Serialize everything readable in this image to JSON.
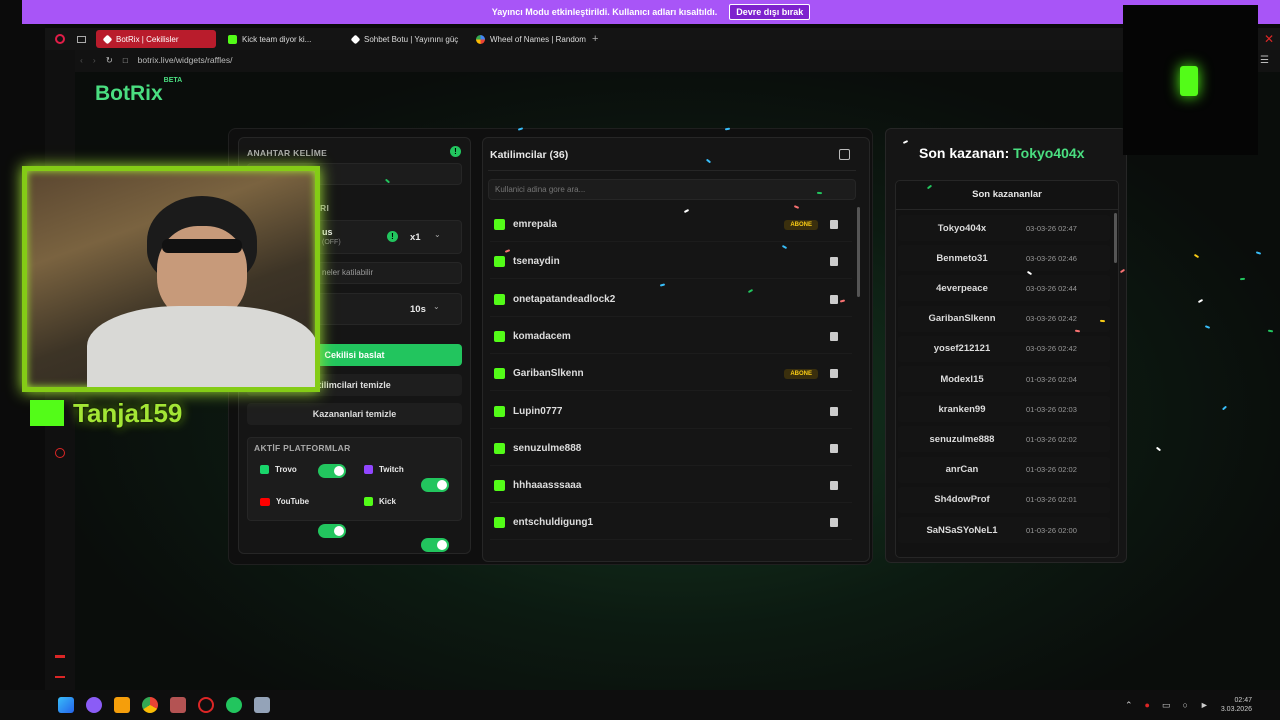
{
  "banner": {
    "text": "Yayıncı Modu etkinleştirildi. Kullanıcı adları kısaltıldı.",
    "button": "Devre dışı bırak"
  },
  "tabs": [
    {
      "label": "BotRix | Cekilisler",
      "color": "#ffffff"
    },
    {
      "label": "Kick team diyor ki...",
      "color": "#53fc18"
    },
    {
      "label": "Sohbet Botu | Yayınını güç",
      "color": "#ffffff"
    },
    {
      "label": "Wheel of Names | Random",
      "color": "#4285f4"
    }
  ],
  "address": "botrix.live/widgets/raffles/",
  "logo": {
    "name": "BotRix",
    "beta": "BETA"
  },
  "left_panel": {
    "keyword_label": "ANAHTAR KELİME",
    "section_fragment": "RI",
    "bonus_fragment": "us",
    "bonus_state": "(OFF)",
    "multiplier": "x1",
    "subs_fragment": "neler katilabilir",
    "timer": "10s",
    "start_button": "Cekilisi baslat",
    "clear_participants": "tilimcilari temizle",
    "clear_winners": "Kazananlari temizle",
    "platforms_label": "AKTİF PLATFORMLAR",
    "platforms": [
      {
        "name": "Trovo",
        "icon": "trovo-icon",
        "enabled": true
      },
      {
        "name": "Twitch",
        "icon": "twitch-icon",
        "enabled": true
      },
      {
        "name": "YouTube",
        "icon": "youtube-icon",
        "enabled": true
      },
      {
        "name": "Kick",
        "icon": "kick-icon",
        "enabled": true
      }
    ]
  },
  "participants": {
    "title": "Katilimcilar (36)",
    "search_placeholder": "Kullanici adina gore ara...",
    "badge_label": "ABONE",
    "items": [
      {
        "name": "emrepala",
        "sub": true
      },
      {
        "name": "tsenaydin",
        "sub": false
      },
      {
        "name": "onetapatandeadlock2",
        "sub": false
      },
      {
        "name": "komadacem",
        "sub": false
      },
      {
        "name": "GaribanSlkenn",
        "sub": true
      },
      {
        "name": "Lupin0777",
        "sub": false
      },
      {
        "name": "senuzulme888",
        "sub": false
      },
      {
        "name": "hhhaaasssaaa",
        "sub": false
      },
      {
        "name": "entschuldigung1",
        "sub": false
      }
    ]
  },
  "winners": {
    "last_winner_label": "Son kazanan:",
    "last_winner_name": "Tokyo404x",
    "list_title": "Son kazananlar",
    "items": [
      {
        "name": "Tokyo404x",
        "date": "03-03-26 02:47"
      },
      {
        "name": "Benmeto31",
        "date": "03-03-26 02:46"
      },
      {
        "name": "4everpeace",
        "date": "03-03-26 02:44"
      },
      {
        "name": "GaribanSlkenn",
        "date": "03-03-26 02:42"
      },
      {
        "name": "yosef212121",
        "date": "03-03-26 02:42"
      },
      {
        "name": "Modexl15",
        "date": "01-03-26 02:04"
      },
      {
        "name": "kranken99",
        "date": "01-03-26 02:03"
      },
      {
        "name": "senuzulme888",
        "date": "01-03-26 02:02"
      },
      {
        "name": "anrCan",
        "date": "01-03-26 02:02"
      },
      {
        "name": "Sh4dowProf",
        "date": "01-03-26 02:01"
      },
      {
        "name": "SaNSaSYoNeL1",
        "date": "01-03-26 02:00"
      }
    ]
  },
  "streamer": {
    "name": "Tanja159"
  },
  "clock": {
    "time": "02:47",
    "date": "3.03.2026"
  },
  "colors": {
    "accent": "#22c55e",
    "kick": "#53fc18",
    "banner": "#a855f7",
    "tab_active": "#b91c2c"
  }
}
